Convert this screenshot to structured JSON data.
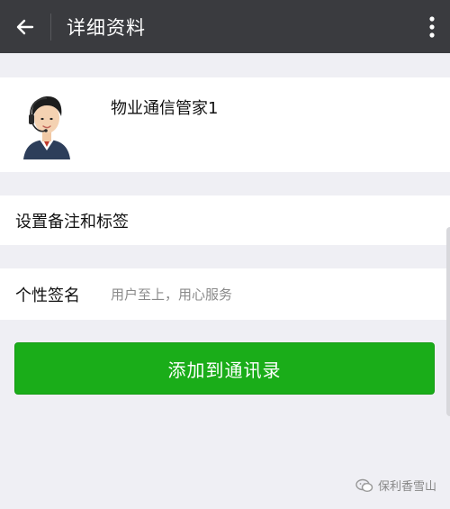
{
  "header": {
    "title": "详细资料"
  },
  "icons": {
    "back": "arrow-left-icon",
    "more": "more-vertical-icon",
    "watermark": "wechat-official-icon"
  },
  "profile": {
    "name": "物业通信管家1"
  },
  "rows": {
    "remark_label": "设置备注和标签",
    "signature_label": "个性签名",
    "signature_value": "用户至上，用心服务"
  },
  "actions": {
    "add_contact_label": "添加到通讯录"
  },
  "watermark": {
    "text": "保利香雪山"
  },
  "colors": {
    "topbar": "#3a3b3f",
    "accent": "#1aad19",
    "background": "#efeff4"
  }
}
